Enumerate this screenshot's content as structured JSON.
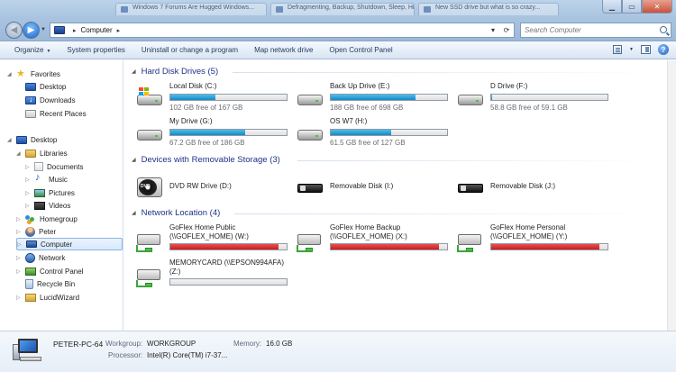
{
  "titlebar": {
    "background_tabs": [
      "Windows 7 Forums Are Hugged Windows...",
      "Defragmenting, Backup, Shutdown, Sleep, Hi...",
      "New SSD drive but what is so crazy..."
    ]
  },
  "address_bar": {
    "path": [
      "Computer"
    ],
    "search_placeholder": "Search Computer"
  },
  "command_bar": {
    "items": [
      {
        "label": "Organize",
        "has_dropdown": true
      },
      {
        "label": "System properties"
      },
      {
        "label": "Uninstall or change a program"
      },
      {
        "label": "Map network drive"
      },
      {
        "label": "Open Control Panel"
      }
    ],
    "right_icons": [
      "change-view-icon",
      "preview-pane-icon",
      "help-icon"
    ]
  },
  "nav_pane": {
    "favorites_label": "Favorites",
    "favorites": [
      "Desktop",
      "Downloads",
      "Recent Places"
    ],
    "desktop_label": "Desktop",
    "libraries_label": "Libraries",
    "libraries": [
      "Documents",
      "Music",
      "Pictures",
      "Videos"
    ],
    "homegroup_label": "Homegroup",
    "user_label": "Peter",
    "computer_label": "Computer",
    "network_label": "Network",
    "control_panel_label": "Control Panel",
    "recycle_bin_label": "Recycle Bin",
    "lucidwizard_label": "LucidWizard"
  },
  "content": {
    "groups": [
      {
        "title": "Hard Disk Drives (5)",
        "drives": [
          {
            "name": "Local Disk (C:)",
            "free_text": "102 GB free of 167 GB",
            "used_fraction": 0.39,
            "icon": "windows-hdd-icon"
          },
          {
            "name": "Back Up Drive (E:)",
            "free_text": "188 GB free of 698 GB",
            "used_fraction": 0.73,
            "icon": "hard-disk-icon"
          },
          {
            "name": "D Drive (F:)",
            "free_text": "58.8 GB free of 59.1 GB",
            "used_fraction": 0.01,
            "icon": "hard-disk-icon"
          },
          {
            "name": "My Drive (G:)",
            "free_text": "67.2 GB free of 186 GB",
            "used_fraction": 0.64,
            "icon": "hard-disk-icon"
          },
          {
            "name": "OS W7 (H:)",
            "free_text": "61.5 GB free of 127 GB",
            "used_fraction": 0.52,
            "icon": "hard-disk-icon"
          }
        ]
      },
      {
        "title": "Devices with Removable Storage (3)",
        "drives": [
          {
            "name": "DVD RW Drive (D:)",
            "icon": "dvd-drive-icon"
          },
          {
            "name": "Removable Disk (I:)",
            "icon": "removable-disk-icon"
          },
          {
            "name": "Removable Disk (J:)",
            "icon": "removable-disk-icon"
          }
        ]
      },
      {
        "title": "Network Location (4)",
        "drives": [
          {
            "name_line1": "GoFlex Home Public",
            "name_line2": "(\\\\GOFLEX_HOME) (W:)",
            "used_fraction": 0.93,
            "icon": "network-drive-icon"
          },
          {
            "name_line1": "GoFlex Home Backup",
            "name_line2": "(\\\\GOFLEX_HOME) (X:)",
            "used_fraction": 0.93,
            "icon": "network-drive-icon"
          },
          {
            "name_line1": "GoFlex Home Personal",
            "name_line2": "(\\\\GOFLEX_HOME) (Y:)",
            "used_fraction": 0.93,
            "icon": "network-drive-icon"
          },
          {
            "name_line1": "MEMORYCARD (\\\\EPSON994AFA)",
            "name_line2": "(Z:)",
            "used_fraction": 0.0,
            "icon": "network-drive-icon"
          }
        ]
      }
    ]
  },
  "details_pane": {
    "computer_name": "PETER-PC-64",
    "workgroup_label": "Workgroup:",
    "workgroup_value": "WORKGROUP",
    "memory_label": "Memory:",
    "memory_value": "16.0 GB",
    "processor_label": "Processor:",
    "processor_value": "Intel(R) Core(TM) i7-37..."
  },
  "colors": {
    "bar_fill": "#26a0da",
    "bar_fill_full": "#da2626",
    "group_header": "#1e3287",
    "network_green": "#39a53b"
  }
}
